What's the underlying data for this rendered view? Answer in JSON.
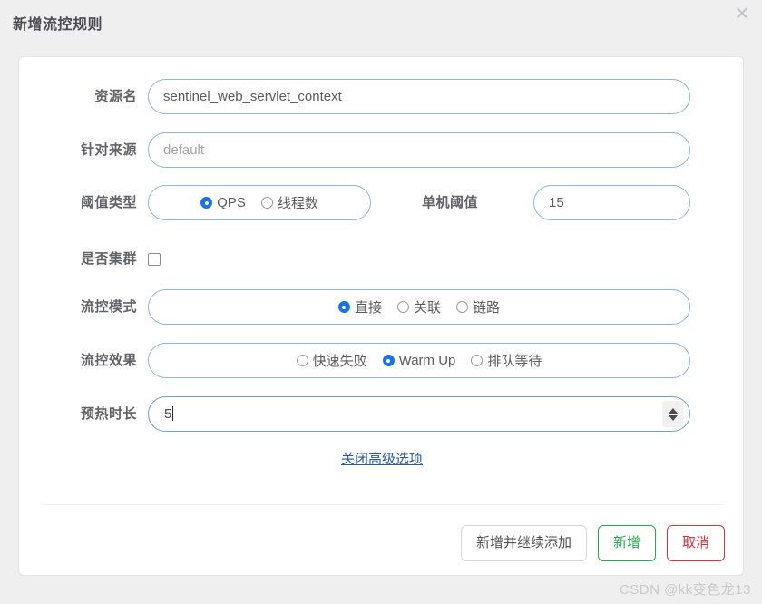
{
  "dialog": {
    "title": "新增流控规则",
    "close_icon": "close-icon",
    "close_glyph": "✕"
  },
  "form": {
    "rows": [
      {
        "label": "资源名",
        "type": "text",
        "value": "sentinel_web_servlet_context",
        "is_placeholder": false
      },
      {
        "label": "针对来源",
        "type": "text",
        "value": "default",
        "is_placeholder": true
      },
      {
        "label": "阈值类型",
        "type": "radio",
        "options": [
          {
            "label": "QPS",
            "checked": true
          },
          {
            "label": "线程数",
            "checked": false
          }
        ],
        "side_label": "单机阈值",
        "side_value": "15"
      },
      {
        "label": "是否集群",
        "type": "checkbox",
        "checked": false
      },
      {
        "label": "流控模式",
        "type": "radio",
        "options": [
          {
            "label": "直接",
            "checked": true
          },
          {
            "label": "关联",
            "checked": false
          },
          {
            "label": "链路",
            "checked": false
          }
        ]
      },
      {
        "label": "流控效果",
        "type": "radio",
        "options": [
          {
            "label": "快速失败",
            "checked": false
          },
          {
            "label": "Warm Up",
            "checked": true
          },
          {
            "label": "排队等待",
            "checked": false
          }
        ]
      },
      {
        "label": "预热时长",
        "type": "number",
        "value": "5"
      }
    ],
    "advanced_link": "关闭高级选项"
  },
  "footer": {
    "buttons": [
      {
        "label": "新增并继续添加",
        "style": "default"
      },
      {
        "label": "新增",
        "style": "success"
      },
      {
        "label": "取消",
        "style": "danger"
      }
    ]
  },
  "watermark": "CSDN @kk变色龙13",
  "colors": {
    "accent_blue": "#1a73e8",
    "field_border": "#8fb6d6",
    "link": "#2b5aa0",
    "success": "#2aa84a",
    "danger": "#d9333f",
    "page_bg": "#efefef",
    "panel_bg": "#ffffff"
  }
}
